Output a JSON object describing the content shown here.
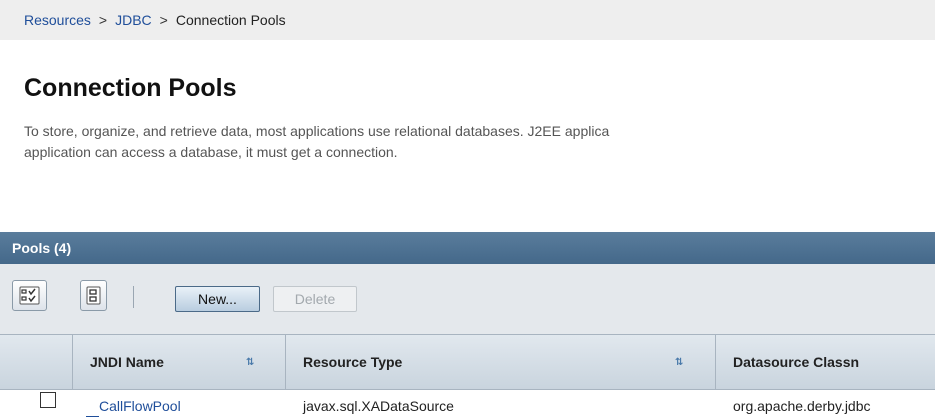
{
  "breadcrumb": {
    "items": [
      "Resources",
      "JDBC",
      "Connection Pools"
    ],
    "separator": ">"
  },
  "page": {
    "title": "Connection Pools",
    "description_line1": "To store, organize, and retrieve data, most applications use relational databases. J2EE applica",
    "description_line2": "application can access a database, it must get a connection."
  },
  "pools_table": {
    "header": "Pools (4)",
    "toolbar": {
      "select_all_icon": "select-all-icon",
      "deselect_all_icon": "deselect-all-icon",
      "new_label": "New...",
      "delete_label": "Delete"
    },
    "columns": [
      "JNDI Name",
      "Resource Type",
      "Datasource Classn"
    ],
    "sort_icon": "sort-icon",
    "rows": [
      {
        "jndi_name": "CallFlowPool",
        "resource_type": "javax.sql.XADataSource",
        "datasource_classname": "org.apache.derby.jdbc"
      }
    ]
  },
  "colors": {
    "header_bar": "#4f7394",
    "link": "#1f4e9a",
    "toolbar_bg": "#e4e8ec"
  }
}
